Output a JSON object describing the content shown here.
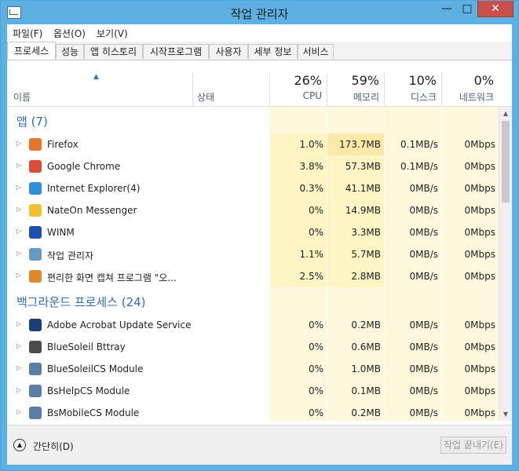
{
  "window": {
    "title": "작업 관리자",
    "minimize": "—",
    "maximize": "□",
    "close": "✕"
  },
  "menu": [
    "파일(F)",
    "옵션(O)",
    "보기(V)"
  ],
  "tabs": [
    "프로세스",
    "성능",
    "앱 히스토리",
    "시작프로그램",
    "사용자",
    "세부 정보",
    "서비스"
  ],
  "columns": {
    "name": "이름",
    "status": "상태",
    "cpu": {
      "pct": "26%",
      "label": "CPU"
    },
    "memory": {
      "pct": "59%",
      "label": "메모리"
    },
    "disk": {
      "pct": "10%",
      "label": "디스크"
    },
    "network": {
      "pct": "0%",
      "label": "네트워크"
    }
  },
  "groups": [
    {
      "label": "앱 (7)",
      "rows": [
        {
          "name": "Firefox",
          "cpu": "1.0%",
          "memory": "173.7MB",
          "disk": "0.1MB/s",
          "network": "0Mbps",
          "icon": "firefox-icon",
          "color": "#e8742c"
        },
        {
          "name": "Google Chrome",
          "cpu": "3.8%",
          "memory": "57.3MB",
          "disk": "0.1MB/s",
          "network": "0Mbps",
          "icon": "chrome-icon",
          "color": "#dd4b39"
        },
        {
          "name": "Internet Explorer(4)",
          "cpu": "0.3%",
          "memory": "41.1MB",
          "disk": "0MB/s",
          "network": "0Mbps",
          "icon": "internet-explorer-icon",
          "color": "#2f8fdc"
        },
        {
          "name": "NateOn Messenger",
          "cpu": "0%",
          "memory": "14.9MB",
          "disk": "0MB/s",
          "network": "0Mbps",
          "icon": "nateon-icon",
          "color": "#f0c232"
        },
        {
          "name": "WINM",
          "cpu": "0%",
          "memory": "3.3MB",
          "disk": "0MB/s",
          "network": "0Mbps",
          "icon": "winm-icon",
          "color": "#1d4fb3"
        },
        {
          "name": "작업 관리자",
          "cpu": "1.1%",
          "memory": "5.7MB",
          "disk": "0MB/s",
          "network": "0Mbps",
          "icon": "task-manager-icon",
          "color": "#6a98c6"
        },
        {
          "name": "편리한 화면 캡쳐 프로그램 \"오...",
          "cpu": "2.5%",
          "memory": "2.8MB",
          "disk": "0MB/s",
          "network": "0Mbps",
          "icon": "capture-program-icon",
          "color": "#e3882a"
        }
      ]
    },
    {
      "label": "백그라운드 프로세스 (24)",
      "rows": [
        {
          "name": "Adobe Acrobat Update Service",
          "cpu": "0%",
          "memory": "0.2MB",
          "disk": "0MB/s",
          "network": "0Mbps",
          "icon": "service-window-icon",
          "color": "#1c3f7a"
        },
        {
          "name": "BlueSoleil Bttray",
          "cpu": "0%",
          "memory": "0.6MB",
          "disk": "0MB/s",
          "network": "0Mbps",
          "icon": "bluetooth-icon",
          "color": "#4c4c4c"
        },
        {
          "name": "BlueSoleilCS Module",
          "cpu": "0%",
          "memory": "1.0MB",
          "disk": "0MB/s",
          "network": "0Mbps",
          "icon": "module-window-icon",
          "color": "#5a7ea8"
        },
        {
          "name": "BsHelpCS Module",
          "cpu": "0%",
          "memory": "0.1MB",
          "disk": "0MB/s",
          "network": "0Mbps",
          "icon": "module-window-icon",
          "color": "#5a7ea8"
        },
        {
          "name": "BsMobileCS Module",
          "cpu": "0%",
          "memory": "0.2MB",
          "disk": "0MB/s",
          "network": "0Mbps",
          "icon": "module-window-icon",
          "color": "#5a7ea8"
        }
      ]
    }
  ],
  "footer": {
    "collapse": "간단히(D)",
    "end_task": "작업 끝내기(E)"
  },
  "colors": {
    "cpu_bg": "#fff4c4",
    "mem_bg": "#ffe9a8",
    "light_bg": "#fff8dc",
    "accent": "#2e6db5"
  }
}
